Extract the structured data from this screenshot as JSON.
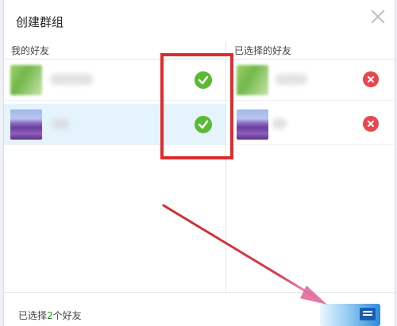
{
  "dialog": {
    "title": "创建群组",
    "close_icon": "close-icon"
  },
  "left_pane": {
    "header": "我的好友",
    "friends": [
      {
        "avatar": "blurred-avatar",
        "selected": false,
        "checked": true
      },
      {
        "avatar": "lavender-field-avatar",
        "selected": true,
        "checked": true
      }
    ]
  },
  "right_pane": {
    "header": "已选择的好友",
    "selected": [
      {
        "avatar": "blurred-avatar"
      },
      {
        "avatar": "lavender-field-avatar"
      }
    ]
  },
  "footer": {
    "prefix": "已选择",
    "count": "2",
    "suffix": "个好友"
  },
  "colors": {
    "check": "#5cb934",
    "remove": "#e5484d",
    "annotation": "#dd2c2c",
    "selected_row": "#e5f3fc"
  }
}
